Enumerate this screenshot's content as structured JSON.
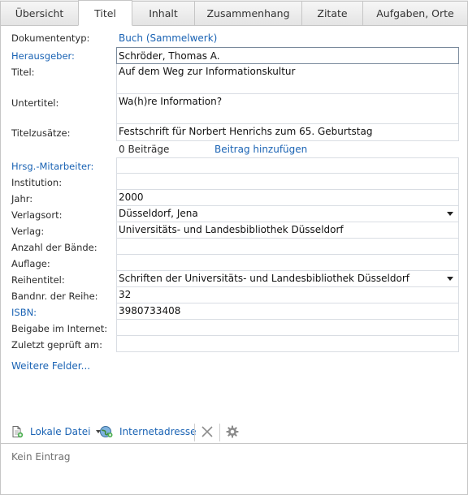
{
  "tabs": [
    {
      "label": "Übersicht"
    },
    {
      "label": "Titel"
    },
    {
      "label": "Inhalt"
    },
    {
      "label": "Zusammenhang"
    },
    {
      "label": "Zitate"
    },
    {
      "label": "Aufgaben, Orte"
    }
  ],
  "active_tab": "Titel",
  "form": {
    "dokumententyp": {
      "label": "Dokumententyp:",
      "value": "Buch (Sammelwerk)"
    },
    "herausgeber": {
      "label": "Herausgeber:",
      "value": "Schröder, Thomas A."
    },
    "titel": {
      "label": "Titel:",
      "value": "Auf dem Weg zur Informationskultur"
    },
    "untertitel": {
      "label": "Untertitel:",
      "value": "Wa(h)re Information?"
    },
    "titelzusaetze": {
      "label": "Titelzusätze:",
      "value": "Festschrift für Norbert Henrichs zum 65. Geburtstag"
    },
    "beitraege": {
      "count_text": "0 Beiträge",
      "add_link": "Beitrag hinzufügen"
    },
    "mitarbeiter": {
      "label": "Hrsg.-Mitarbeiter:",
      "value": ""
    },
    "institution": {
      "label": "Institution:",
      "value": ""
    },
    "jahr": {
      "label": "Jahr:",
      "value": "2000"
    },
    "verlagsort": {
      "label": "Verlagsort:",
      "value": "Düsseldorf, Jena"
    },
    "verlag": {
      "label": "Verlag:",
      "value": "Universitäts- und Landesbibliothek Düsseldorf"
    },
    "baende": {
      "label": "Anzahl der Bände:",
      "value": ""
    },
    "auflage": {
      "label": "Auflage:",
      "value": ""
    },
    "reihentitel": {
      "label": "Reihentitel:",
      "value": "Schriften der Universitäts- und Landesbibliothek Düsseldorf"
    },
    "bandnr": {
      "label": "Bandnr. der Reihe:",
      "value": "32"
    },
    "isbn": {
      "label": "ISBN:",
      "value": "3980733408"
    },
    "beigabe": {
      "label": "Beigabe im Internet:",
      "value": ""
    },
    "geprueft": {
      "label": "Zuletzt geprüft am:",
      "value": ""
    },
    "weitere": "Weitere Felder..."
  },
  "toolbar": {
    "local_file": "Lokale Datei",
    "internet": "Internetadresse",
    "icons": [
      "local-file-icon",
      "dropdown-arrow-icon",
      "internet-address-icon",
      "delete-icon",
      "settings-gear-icon"
    ]
  },
  "attachments_empty": "Kein Eintrag",
  "colors": {
    "link": "#1a63b4",
    "border": "#c6c6c6",
    "field_border": "#d9dde3"
  }
}
